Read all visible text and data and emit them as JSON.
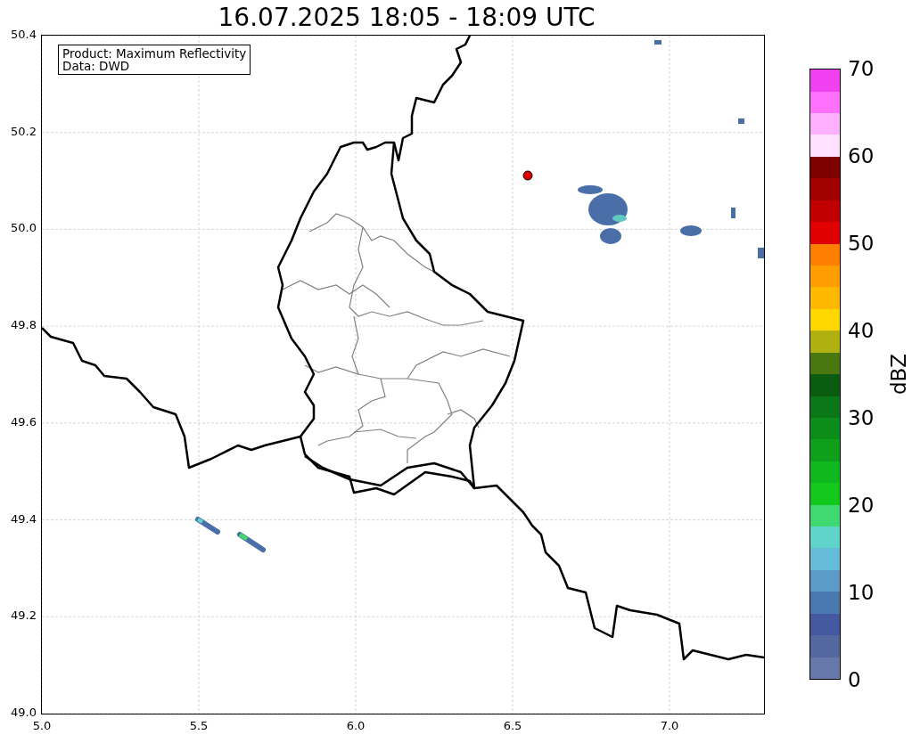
{
  "title": "16.07.2025 18:05 - 18:09 UTC",
  "info_box": [
    "Product: Maximum Reflectivity",
    "Data: DWD"
  ],
  "map": {
    "x_ticks": [
      "5.0",
      "5.5",
      "6.0",
      "6.5",
      "7.0"
    ],
    "y_ticks": [
      "50.4",
      "50.2",
      "50.0",
      "49.8",
      "49.6",
      "49.4",
      "49.2",
      "49.0"
    ]
  },
  "colorbar": {
    "label": "dBZ",
    "ticks": [
      "70",
      "60",
      "50",
      "40",
      "30",
      "20",
      "10",
      "0"
    ]
  }
}
